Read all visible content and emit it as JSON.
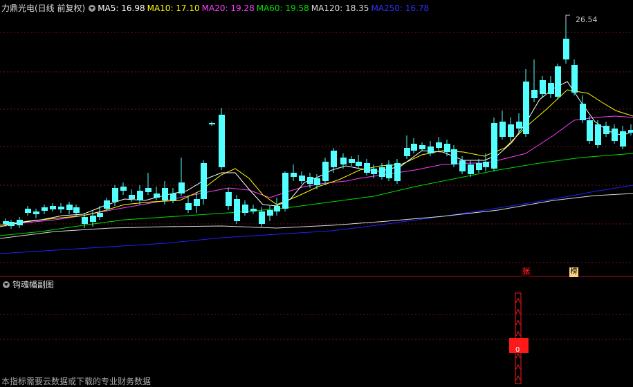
{
  "header": {
    "title": "力鼎光电(日线 前复权)",
    "ma5": "MA5: 16.98",
    "ma10": "MA10: 17.10",
    "ma20": "MA20: 19.28",
    "ma60": "MA60: 19.58",
    "ma120": "MA120: 18.35",
    "ma250": "MA250: 16.78"
  },
  "colors": {
    "ma5": "#ffffff",
    "ma10": "#ffff00",
    "ma20": "#ff40ff",
    "ma60": "#00e000",
    "ma120": "#dddddd",
    "ma250": "#2020ff",
    "up": "#ff3232",
    "down": "#54ffff",
    "grid": "#7a1414"
  },
  "peak_label": "26.54",
  "subchart": {
    "title": "钩魂幡副图",
    "zero_label": "0"
  },
  "tags": {
    "zhang": "张",
    "bang": "榜"
  },
  "footer": "本指标需要云数据或下载的专业财务数据"
}
